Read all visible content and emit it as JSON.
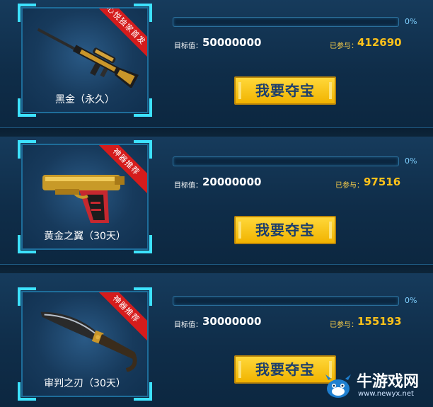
{
  "items": [
    {
      "name": "黑金（永久）",
      "ribbon": "心悦独家首发",
      "progress_fraction": 0.0,
      "progress_text": "0%",
      "target_label": "目标值：",
      "target_value": "50000000",
      "joined_label": "已参与：",
      "joined_value": "412690",
      "button": "我要夺宝",
      "icon": "sniper-rifle-icon"
    },
    {
      "name": "黄金之翼（30天）",
      "ribbon": "神器推荐",
      "progress_fraction": 0.0,
      "progress_text": "0%",
      "target_label": "目标值：",
      "target_value": "20000000",
      "joined_label": "已参与：",
      "joined_value": "97516",
      "button": "我要夺宝",
      "icon": "pistol-icon"
    },
    {
      "name": "审判之刃（30天）",
      "ribbon": "神器推荐",
      "progress_fraction": 0.0,
      "progress_text": "0%",
      "target_label": "目标值：",
      "target_value": "30000000",
      "joined_label": "已参与：",
      "joined_value": "155193",
      "button": "我要夺宝",
      "icon": "knife-icon"
    }
  ],
  "watermark": {
    "text": "牛游戏网",
    "url": "www.newyx.net",
    "icon": "cow-logo-icon"
  },
  "colors": {
    "accent": "#3de2ff",
    "button": "#f1b300",
    "ribbon": "#d51c1c",
    "joined": "#ffc21a"
  }
}
